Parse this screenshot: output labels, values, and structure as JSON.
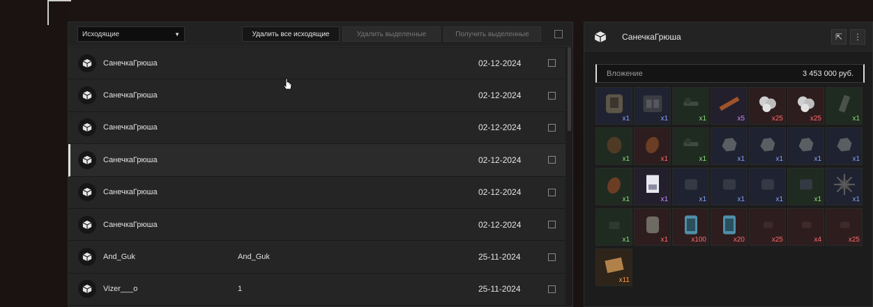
{
  "toolbar": {
    "filter_selected": "Исходящие",
    "delete_all_label": "Удалить все исходящие",
    "delete_selected_label": "Удалить выделенные",
    "receive_selected_label": "Получить выделенные"
  },
  "rows": [
    {
      "sender": "СанечкаГрюша",
      "subject": "",
      "date": "02-12-2024"
    },
    {
      "sender": "СанечкаГрюша",
      "subject": "",
      "date": "02-12-2024"
    },
    {
      "sender": "СанечкаГрюша",
      "subject": "",
      "date": "02-12-2024"
    },
    {
      "sender": "СанечкаГрюша",
      "subject": "",
      "date": "02-12-2024"
    },
    {
      "sender": "СанечкаГрюша",
      "subject": "",
      "date": "02-12-2024"
    },
    {
      "sender": "СанечкаГрюша",
      "subject": "",
      "date": "02-12-2024"
    },
    {
      "sender": "And_Guk",
      "subject": "And_Guk",
      "date": "25-11-2024"
    },
    {
      "sender": "Vizer___o",
      "subject": "1",
      "date": "25-11-2024"
    }
  ],
  "selected_row_index": 3,
  "detail": {
    "title": "СанечкаГрюша",
    "attachment_label": "Вложение",
    "attachment_value": "3 453 000 руб."
  },
  "items": [
    {
      "icon": "armor-vest-icon",
      "rarity": "blue",
      "qty": "x1"
    },
    {
      "icon": "rig-icon",
      "rarity": "blue",
      "qty": "x1"
    },
    {
      "icon": "scope-icon",
      "rarity": "green",
      "qty": "x1"
    },
    {
      "icon": "grenade-launcher-icon",
      "rarity": "purple",
      "qty": "x5"
    },
    {
      "icon": "ammo-box-icon",
      "rarity": "red",
      "qty": "x25"
    },
    {
      "icon": "ammo-box-icon",
      "rarity": "red",
      "qty": "x25"
    },
    {
      "icon": "magazine-icon",
      "rarity": "green",
      "qty": "x1"
    },
    {
      "icon": "pouch-icon",
      "rarity": "green",
      "qty": "x1"
    },
    {
      "icon": "grenade-icon",
      "rarity": "red",
      "qty": "x1"
    },
    {
      "icon": "scope-icon",
      "rarity": "green",
      "qty": "x1"
    },
    {
      "icon": "rock-icon",
      "rarity": "blue",
      "qty": "x1"
    },
    {
      "icon": "rock-icon",
      "rarity": "blue",
      "qty": "x1"
    },
    {
      "icon": "rock-icon",
      "rarity": "blue",
      "qty": "x1"
    },
    {
      "icon": "rock-icon",
      "rarity": "blue",
      "qty": "x1"
    },
    {
      "icon": "grenade-icon",
      "rarity": "green",
      "qty": "x1"
    },
    {
      "icon": "document-icon",
      "rarity": "purple",
      "qty": "x1"
    },
    {
      "icon": "device-icon",
      "rarity": "blue",
      "qty": "x1"
    },
    {
      "icon": "device-icon",
      "rarity": "blue",
      "qty": "x1"
    },
    {
      "icon": "device-icon",
      "rarity": "blue",
      "qty": "x1"
    },
    {
      "icon": "device-icon",
      "rarity": "green",
      "qty": "x1"
    },
    {
      "icon": "spiked-ball-icon",
      "rarity": "blue",
      "qty": "x1"
    },
    {
      "icon": "attachment-icon",
      "rarity": "green",
      "qty": "x1"
    },
    {
      "icon": "canister-icon",
      "rarity": "red",
      "qty": "x1"
    },
    {
      "icon": "battery-icon",
      "rarity": "red",
      "qty": "x100"
    },
    {
      "icon": "battery-icon",
      "rarity": "red",
      "qty": "x20"
    },
    {
      "icon": "bullet-icon",
      "rarity": "red",
      "qty": "x25"
    },
    {
      "icon": "bullet-icon",
      "rarity": "red",
      "qty": "x4"
    },
    {
      "icon": "bullet-icon",
      "rarity": "red",
      "qty": "x25"
    },
    {
      "icon": "book-icon",
      "rarity": "orange",
      "qty": "x11"
    }
  ]
}
